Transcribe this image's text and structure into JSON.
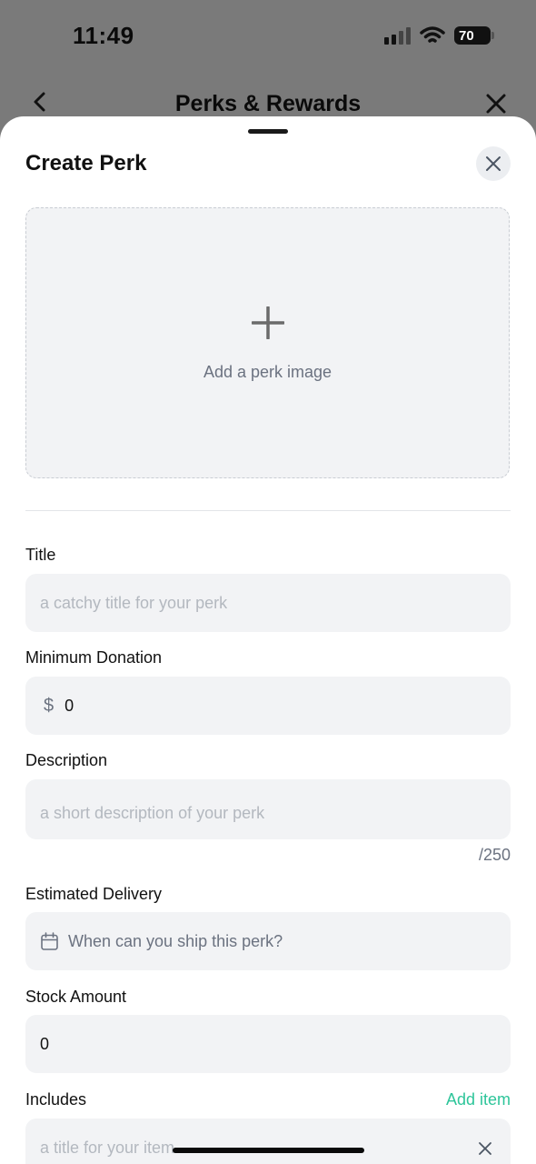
{
  "status_bar": {
    "time": "11:49",
    "battery": "70"
  },
  "header": {
    "title": "Perks & Rewards"
  },
  "sheet": {
    "title": "Create Perk",
    "image_upload": {
      "label": "Add a perk image"
    },
    "fields": {
      "title": {
        "label": "Title",
        "placeholder": "a catchy title for your perk",
        "value": ""
      },
      "minimum_donation": {
        "label": "Minimum Donation",
        "currency_symbol": "$",
        "value": "0"
      },
      "description": {
        "label": "Description",
        "placeholder": "a short description of your perk",
        "value": "",
        "counter": "/250"
      },
      "estimated_delivery": {
        "label": "Estimated Delivery",
        "placeholder": "When can you ship this perk?"
      },
      "stock_amount": {
        "label": "Stock Amount",
        "value": "0"
      },
      "includes": {
        "label": "Includes",
        "add_label": "Add item",
        "item_placeholder": "a title for your item"
      }
    }
  },
  "colors": {
    "accent": "#2ec59a",
    "field_bg": "#f2f3f5",
    "placeholder": "#b3b8bf",
    "muted_text": "#6b7280"
  }
}
